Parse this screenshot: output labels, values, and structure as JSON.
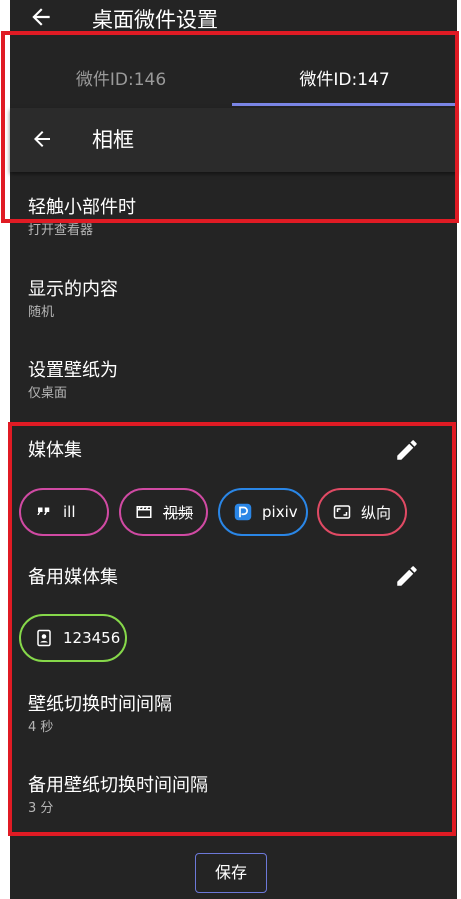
{
  "app_bar": {
    "title": "桌面微件设置"
  },
  "tabs": [
    {
      "label": "微件ID:146",
      "selected": false
    },
    {
      "label": "微件ID:147",
      "selected": true
    }
  ],
  "subheader": {
    "title": "相框"
  },
  "settings": [
    {
      "label": "轻触小部件时",
      "value": "打开查看器"
    },
    {
      "label": "显示的内容",
      "value": "随机"
    },
    {
      "label": "设置壁纸为",
      "value": "仅桌面"
    }
  ],
  "media_set": {
    "title": "媒体集",
    "chips": [
      {
        "icon": "quote-icon",
        "label": "ill",
        "color": "#d04aa3"
      },
      {
        "icon": "clapperboard-icon",
        "label": "视频",
        "color": "#d04aa3",
        "strikethrough": true
      },
      {
        "icon": "pixiv-icon",
        "label": "pixiv",
        "color": "#2a86e6"
      },
      {
        "icon": "aspect-ratio-icon",
        "label": "纵向",
        "color": "#e04a64"
      }
    ]
  },
  "backup_media_set": {
    "title": "备用媒体集",
    "chips": [
      {
        "icon": "portrait-icon",
        "label": "123456",
        "color": "#86d84a"
      }
    ]
  },
  "intervals": [
    {
      "label": "壁纸切换时间间隔",
      "value": "4 秒"
    },
    {
      "label": "备用壁纸切换时间间隔",
      "value": "3 分"
    }
  ],
  "save_label": "保存",
  "colors": {
    "background": "#242424",
    "tab_indicator": "#7b86e6",
    "highlight_border": "#e01b24"
  }
}
